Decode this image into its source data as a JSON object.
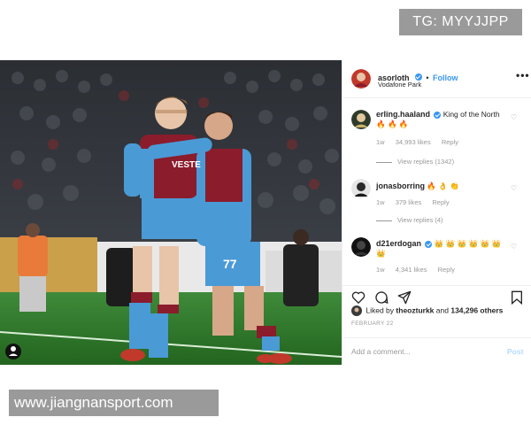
{
  "watermarks": {
    "top": "TG: MYYJJPP",
    "bottom": "www.jiangnansport.com"
  },
  "photo": {
    "shirt_sponsor": "VESTE",
    "shirt_number": "77"
  },
  "header": {
    "username": "asorloth",
    "follow_label": "Follow",
    "location": "Vodafone Park",
    "more_icon": "•••"
  },
  "comments": [
    {
      "username": "erling.haaland",
      "text": "King of the North",
      "emoji": "🔥 🔥 🔥",
      "age": "1w",
      "likes": "34,993 likes",
      "reply_label": "Reply",
      "view_replies": "View replies (1342)"
    },
    {
      "username": "jonasborring",
      "text": "",
      "emoji": "🔥 👌 👏",
      "age": "1w",
      "likes": "379 likes",
      "reply_label": "Reply",
      "view_replies": "View replies (4)"
    },
    {
      "username": "d21erdogan",
      "text": "",
      "emoji": "👑 👑 👑 👑 👑 👑 👑",
      "age": "1w",
      "likes": "4,341 likes",
      "reply_label": "Reply",
      "view_replies": ""
    }
  ],
  "likes_line": {
    "prefix": "Liked by",
    "user": "theozturkk",
    "joiner": "and",
    "count": "134,296 others"
  },
  "date": "FEBRUARY 22",
  "add_comment": {
    "placeholder": "Add a comment...",
    "post_label": "Post"
  },
  "colors": {
    "accent": "#3897f0",
    "trabzon_claret": "#8b1c2c",
    "trabzon_blue": "#4a9ad6",
    "pitch": "#2f7a2e"
  }
}
